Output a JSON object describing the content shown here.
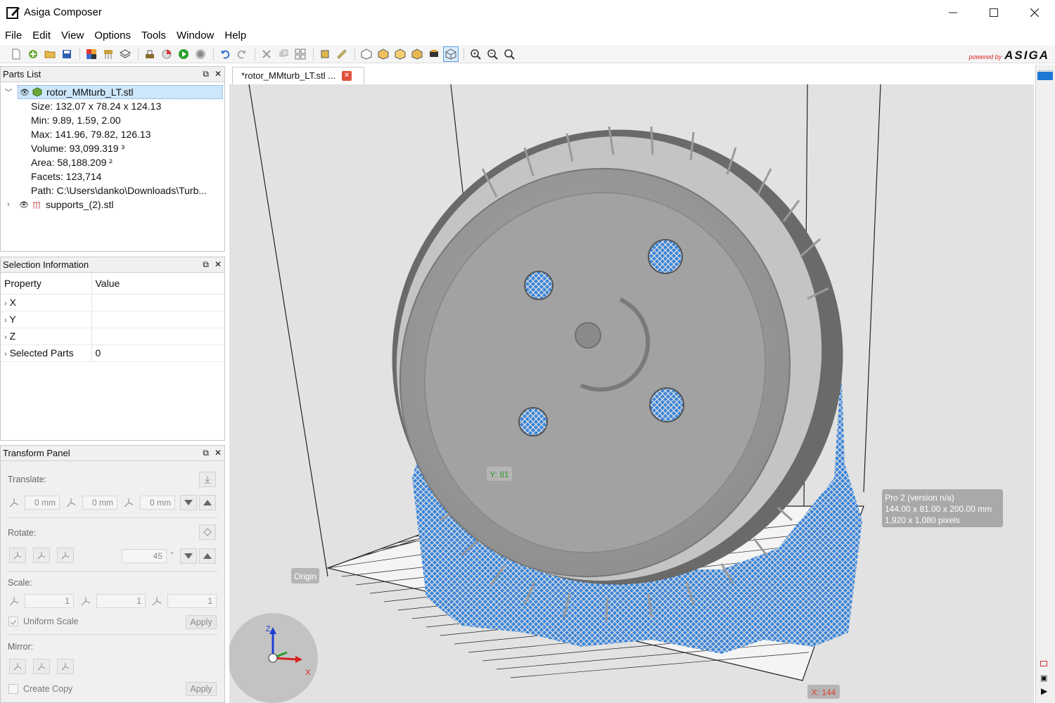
{
  "window": {
    "title": "Asiga Composer"
  },
  "menu": [
    "File",
    "Edit",
    "View",
    "Options",
    "Tools",
    "Window",
    "Help"
  ],
  "brand": {
    "powered": "powered by",
    "name": "ASIGA"
  },
  "tab": {
    "label": "*rotor_MMturb_LT.stl ..."
  },
  "parts_list": {
    "title": "Parts List",
    "part": {
      "name": "rotor_MMturb_LT.stl",
      "details": [
        "Size: 132.07 x 78.24 x 124.13",
        "Min: 9.89, 1.59, 2.00",
        "Max: 141.96, 79.82, 126.13",
        "Volume: 93,099.319 ³",
        "Area: 58,188.209 ²",
        "Facets: 123,714",
        "Path: C:\\Users\\danko\\Downloads\\Turb..."
      ]
    },
    "supports": {
      "name": "supports_(2).stl"
    }
  },
  "selection_info": {
    "title": "Selection Information",
    "col_property": "Property",
    "col_value": "Value",
    "rows": [
      {
        "property": "X",
        "value": ""
      },
      {
        "property": "Y",
        "value": ""
      },
      {
        "property": "Z",
        "value": ""
      },
      {
        "property": "Selected Parts",
        "value": "0"
      }
    ]
  },
  "transform": {
    "title": "Transform Panel",
    "translate_label": "Translate:",
    "translate_values": [
      "0 mm",
      "0 mm",
      "0 mm"
    ],
    "rotate_label": "Rotate:",
    "rotate_value": "45",
    "rotate_unit": "°",
    "scale_label": "Scale:",
    "scale_values": [
      "1",
      "1",
      "1"
    ],
    "uniform_scale": "Uniform Scale",
    "apply": "Apply",
    "mirror_label": "Mirror:",
    "create_copy": "Create Copy"
  },
  "viewport": {
    "y_label": "Y: 81",
    "x_label": "X: 144",
    "origin_label": "Origin",
    "printer_info": [
      "Pro 2 (version n/a)",
      "144.00 x 81.00 x 200.00 mm",
      "1,920 x 1,080 pixels"
    ],
    "axis_z": "Z",
    "axis_x": "X"
  },
  "colors": {
    "support_blue": "#3a7fd0",
    "part_gray": "#9a9a9a",
    "accent_red": "#d9442e",
    "axis_green": "#2a9d2a"
  }
}
